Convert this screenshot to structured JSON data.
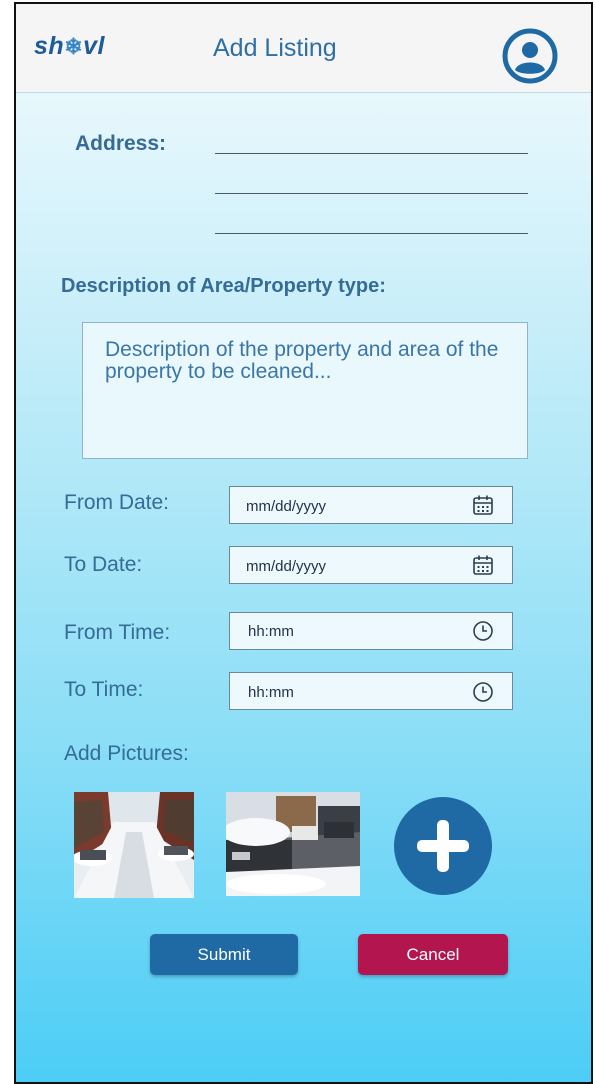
{
  "header": {
    "logo_prefix": "sh",
    "logo_suffix": "vl",
    "title": "Add Listing",
    "profile_icon": "account-circle-icon"
  },
  "form": {
    "address_label": "Address:",
    "description_label": "Description of Area/Property type:",
    "description_placeholder": "Description of the property and area of the property to be cleaned...",
    "from_date_label": "From Date:",
    "from_date_placeholder": "mm/dd/yyyy",
    "to_date_label": "To Date:",
    "to_date_placeholder": "mm/dd/yyyy",
    "from_time_label": "From Time:",
    "from_time_placeholder": "hh:mm",
    "to_time_label": "To Time:",
    "to_time_placeholder": "hh:mm",
    "pictures_label": "Add Pictures:"
  },
  "actions": {
    "submit_label": "Submit",
    "cancel_label": "Cancel"
  },
  "colors": {
    "primary": "#1f6aa5",
    "cancel": "#b3164e",
    "text": "#356b96"
  }
}
